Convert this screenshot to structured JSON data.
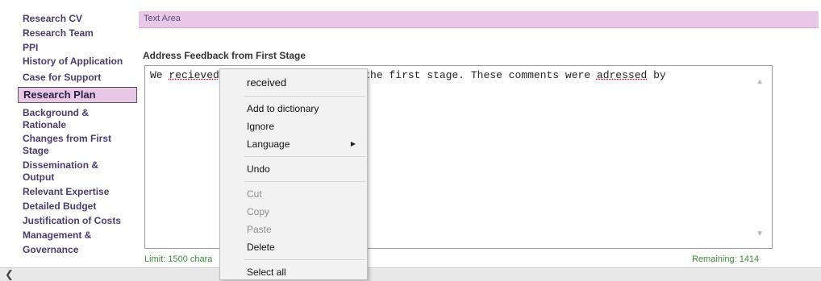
{
  "sidebar": {
    "items": [
      {
        "label": "Research CV"
      },
      {
        "label": "Research Team"
      },
      {
        "label": "PPI"
      },
      {
        "label": "History of Application"
      },
      {
        "label": "Case for Support"
      },
      {
        "label": "Research Plan"
      },
      {
        "label": "Background &"
      },
      {
        "label": "Rationale"
      },
      {
        "label": "Changes from First"
      },
      {
        "label": "Stage"
      },
      {
        "label": "Dissemination &"
      },
      {
        "label": "Output"
      },
      {
        "label": "Relevant Expertise"
      },
      {
        "label": "Detailed Budget"
      },
      {
        "label": "Justification of Costs"
      },
      {
        "label": "Management &"
      },
      {
        "label": "Governance"
      }
    ]
  },
  "main": {
    "header": "Text Area",
    "field_label": "Address Feedback from First Stage",
    "text_prefix": "We ",
    "text_misspelled": "recieved",
    "text_rest": "                     m the first stage. These comments were ",
    "text_misspelled_2": "adressed",
    "text_suffix": " by",
    "limit": "Limit: 1500 chara",
    "remaining": "Remaining: 1414"
  },
  "context_menu": {
    "suggestion": "received",
    "add_to_dictionary": "Add to dictionary",
    "ignore": "Ignore",
    "language": "Language",
    "undo": "Undo",
    "cut": "Cut",
    "copy": "Copy",
    "paste": "Paste",
    "delete": "Delete",
    "select_all": "Select all"
  },
  "icons": {
    "submenu_arrow": "triangle-right-icon",
    "scroll_left": "chevron-left-icon",
    "scroll_up": "chevron-up-icon",
    "scroll_down": "chevron-down-icon"
  }
}
